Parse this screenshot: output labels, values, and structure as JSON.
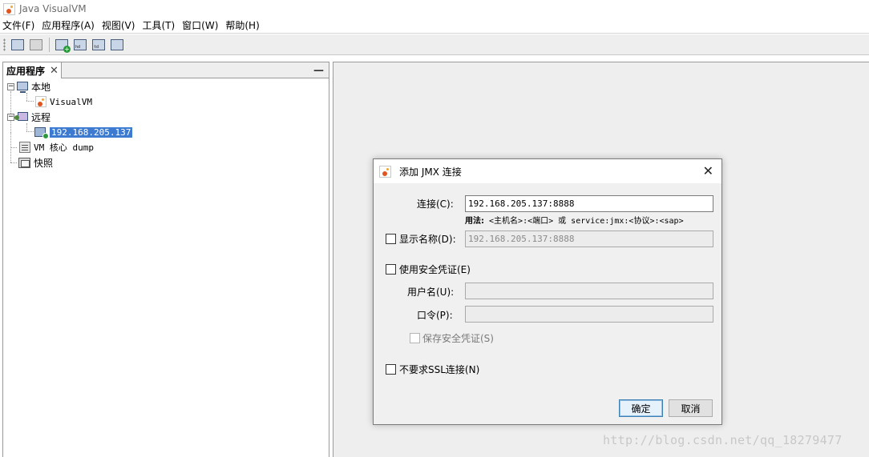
{
  "window": {
    "title": "Java VisualVM",
    "icon": "visualvm-app-icon"
  },
  "menubar": {
    "items": [
      {
        "label": "文件(F)"
      },
      {
        "label": "应用程序(A)"
      },
      {
        "label": "视图(V)"
      },
      {
        "label": "工具(T)"
      },
      {
        "label": "窗口(W)"
      },
      {
        "label": "帮助(H)"
      }
    ]
  },
  "toolbar": {
    "icons": [
      "load-snapshot-icon",
      "save-icon",
      "add-jmx-connection-icon",
      "heap-dump-icon",
      "thread-dump-icon",
      "application-snapshot-icon"
    ]
  },
  "left_panel": {
    "tab_label": "应用程序",
    "close_glyph": "✕",
    "minimize_glyph": "—",
    "tree": {
      "local": {
        "toggle": "−",
        "label": "本地"
      },
      "visualvm": {
        "label": "VisualVM"
      },
      "remote": {
        "toggle": "−",
        "label": "远程"
      },
      "remote_host": {
        "label": "192.168.205.137"
      },
      "core_dump": {
        "label": "VM 核心 dump"
      },
      "snapshots": {
        "label": "快照"
      }
    }
  },
  "dialog": {
    "title": "添加 JMX 连接",
    "close_glyph": "✕",
    "connection_label": "连接(C):",
    "connection_value": "192.168.205.137:8888",
    "usage_prefix": "用法:",
    "usage_text": "<主机名>:<端口> 或 service:jmx:<协议>:<sap>",
    "display_name_label": "显示名称(D):",
    "display_name_value": "192.168.205.137:8888",
    "display_name_checked": false,
    "use_security_label": "使用安全凭证(E)",
    "use_security_checked": false,
    "username_label": "用户名(U):",
    "username_value": "",
    "password_label": "口令(P):",
    "password_value": "",
    "save_credentials_label": "保存安全凭证(S)",
    "no_ssl_label": "不要求SSL连接(N)",
    "no_ssl_checked": false,
    "ok_label": "确定",
    "cancel_label": "取消"
  },
  "watermark": "http://blog.csdn.net/qq_18279477",
  "colors": {
    "selection": "#3d7bd0",
    "default_button_border": "#3c7fb1",
    "panel_background": "#eeeeee"
  }
}
